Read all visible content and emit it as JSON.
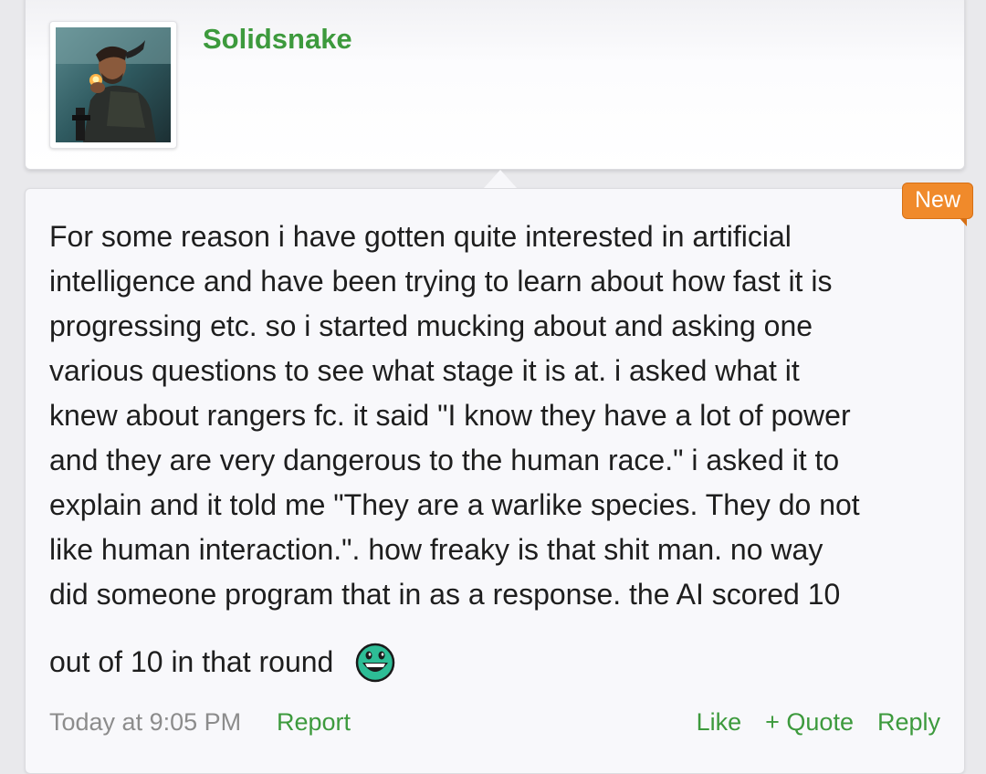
{
  "user": {
    "name": "Solidsnake"
  },
  "post": {
    "badge": "New",
    "body": "For some reason i have gotten quite interested in artificial\nintelligence and have been trying to learn about how fast it is\nprogressing etc. so i started mucking about and asking one\nvarious questions to see what stage it is at. i asked what it\nknew about rangers fc. it said \"I know they have a lot of power\nand they are very dangerous to the human race.\" i asked it to\nexplain and it told me \"They are a warlike species. They do not\nlike human interaction.\". how freaky is that shit man. no way\ndid someone program that in as a response. the AI scored 10",
    "body_end": "out of 10 in that round",
    "smiley_icon": "laughing-smiley-icon",
    "timestamp": "Today at 9:05 PM",
    "report_label": "Report",
    "like_label": "Like",
    "quote_label": "+ Quote",
    "reply_label": "Reply"
  },
  "colors": {
    "link_green": "#3d9a3d",
    "badge_orange": "#f08a2b",
    "timestamp_gray": "#8c8c8c"
  }
}
